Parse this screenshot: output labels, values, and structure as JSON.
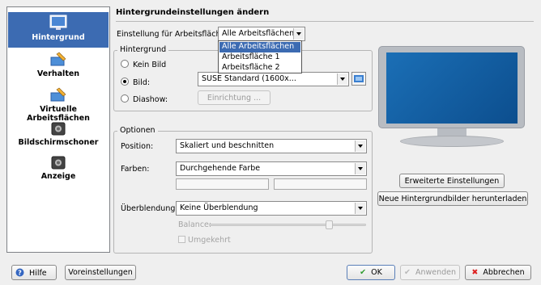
{
  "sidebar": {
    "items": [
      {
        "label": "Hintergrund",
        "icon": "wallpaper-icon",
        "selected": true
      },
      {
        "label": "Verhalten",
        "icon": "desktop-behavior-icon",
        "selected": false
      },
      {
        "label": "Virtuelle Arbeitsflächen",
        "icon": "virtual-desktops-icon",
        "selected": false
      },
      {
        "label": "Bildschirmschoner",
        "icon": "screensaver-icon",
        "selected": false
      },
      {
        "label": "Anzeige",
        "icon": "display-icon",
        "selected": false
      }
    ]
  },
  "header": {
    "title": "Hintergrundeinstellungen ändern"
  },
  "desktop_setting": {
    "label": "Einstellung für Arbeitsfläche:",
    "value": "Alle Arbeitsflächen",
    "options": [
      "Alle Arbeitsflächen",
      "Arbeitsfläche 1",
      "Arbeitsfläche 2"
    ]
  },
  "background_group": {
    "title": "Hintergrund",
    "no_image": "Kein Bild",
    "image": "Bild:",
    "image_value": "SUSE Standard (1600x...",
    "slideshow": "Diashow:",
    "setup_button": "Einrichtung ..."
  },
  "options_group": {
    "title": "Optionen",
    "position_label": "Position:",
    "position_value": "Skaliert und beschnitten",
    "colors_label": "Farben:",
    "colors_value": "Durchgehende Farbe",
    "blending_label": "Überblendung:",
    "blending_value": "Keine Überblendung",
    "balance_label": "Balance:",
    "balance_level": 0.78,
    "reverse_label": "Umgekehrt"
  },
  "right_buttons": {
    "advanced": "Erweiterte Einstellungen",
    "download": "Neue Hintergrundbilder herunterladen"
  },
  "bottom_buttons": {
    "help": "Hilfe",
    "defaults": "Voreinstellungen",
    "ok": "OK",
    "apply": "Anwenden",
    "cancel": "Abbrechen"
  },
  "colors": {
    "selection": "#3c6bb2",
    "monitor_screen": "#1b6fb6"
  }
}
